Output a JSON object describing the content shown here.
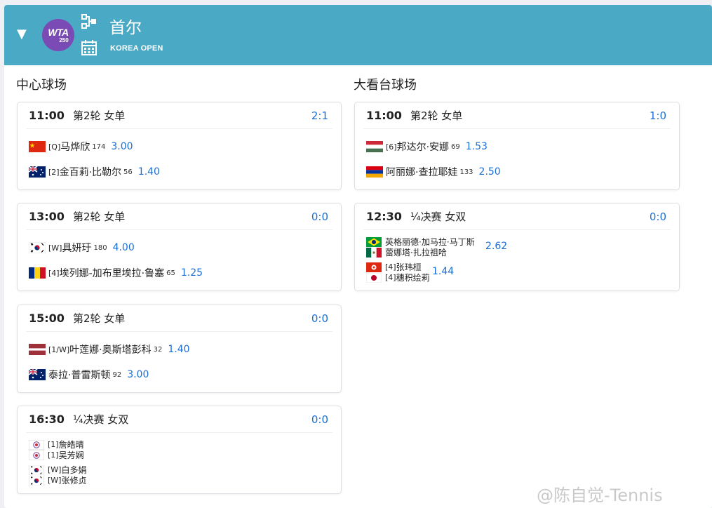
{
  "tournament": {
    "name": "首尔",
    "subtitle": "KOREA OPEN",
    "logo_text": "WTA",
    "logo_level": "250",
    "header_color": "#4aaac6",
    "collapse_icon": "triangle-down-icon"
  },
  "courts": [
    {
      "name": "中心球场",
      "matches": [
        {
          "time": "11:00",
          "round": "第2轮 女单",
          "score": "2:1",
          "players": [
            {
              "flag": "china",
              "seed": "[Q]",
              "name": "马烨欣",
              "rank": "174",
              "odds": "3.00"
            },
            {
              "flag": "australia",
              "seed": "[2]",
              "name": "金百莉·比勒尔",
              "rank": "56",
              "odds": "1.40"
            }
          ]
        },
        {
          "time": "13:00",
          "round": "第2轮 女单",
          "score": "0:0",
          "players": [
            {
              "flag": "korea",
              "seed": "[W]",
              "name": "具妍玗",
              "rank": "180",
              "odds": "4.00"
            },
            {
              "flag": "romania",
              "seed": "[4]",
              "name": "埃列娜-加布里埃拉·鲁塞",
              "rank": "65",
              "odds": "1.25"
            }
          ]
        },
        {
          "time": "15:00",
          "round": "第2轮 女单",
          "score": "0:0",
          "players": [
            {
              "flag": "latvia",
              "seed": "[1/W]",
              "name": "叶莲娜·奥斯塔彭科",
              "rank": "32",
              "odds": "1.40"
            },
            {
              "flag": "australia",
              "seed": "",
              "name": "泰拉·普雷斯顿",
              "rank": "92",
              "odds": "3.00"
            }
          ]
        },
        {
          "time": "16:30",
          "round": "¼决赛 女双",
          "score": "0:0",
          "pairs": [
            {
              "odds": "",
              "players": [
                {
                  "flag": "chinese-taipei",
                  "seed": "[1]",
                  "name": "詹皓晴"
                },
                {
                  "flag": "chinese-taipei",
                  "seed": "[1]",
                  "name": "吴芳娴"
                }
              ]
            },
            {
              "odds": "",
              "players": [
                {
                  "flag": "korea",
                  "seed": "[W]",
                  "name": "白多娟"
                },
                {
                  "flag": "korea",
                  "seed": "[W]",
                  "name": "张修贞"
                }
              ]
            }
          ]
        }
      ]
    },
    {
      "name": "大看台球场",
      "matches": [
        {
          "time": "11:00",
          "round": "第2轮 女单",
          "score": "1:0",
          "players": [
            {
              "flag": "hungary",
              "seed": "[6]",
              "name": "邦达尔·安娜",
              "rank": "69",
              "odds": "1.53"
            },
            {
              "flag": "armenia",
              "seed": "",
              "name": "阿丽娜·查拉耶娃",
              "rank": "133",
              "odds": "2.50"
            }
          ]
        },
        {
          "time": "12:30",
          "round": "¼决赛 女双",
          "score": "0:0",
          "pairs": [
            {
              "odds": "2.62",
              "players": [
                {
                  "flag": "brazil",
                  "seed": "",
                  "name": "英格丽德·加马拉·马丁斯"
                },
                {
                  "flag": "mexico",
                  "seed": "",
                  "name": "蕾娜塔·扎拉祖哈"
                }
              ]
            },
            {
              "odds": "1.44",
              "players": [
                {
                  "flag": "hong-kong",
                  "seed": "[4]",
                  "name": "张玮桓"
                },
                {
                  "flag": "japan",
                  "seed": "[4]",
                  "name": "穗积绘莉"
                }
              ]
            }
          ]
        }
      ]
    }
  ],
  "watermark": "@陈自觉-Tennis",
  "accent_color": "#1a6fd6"
}
